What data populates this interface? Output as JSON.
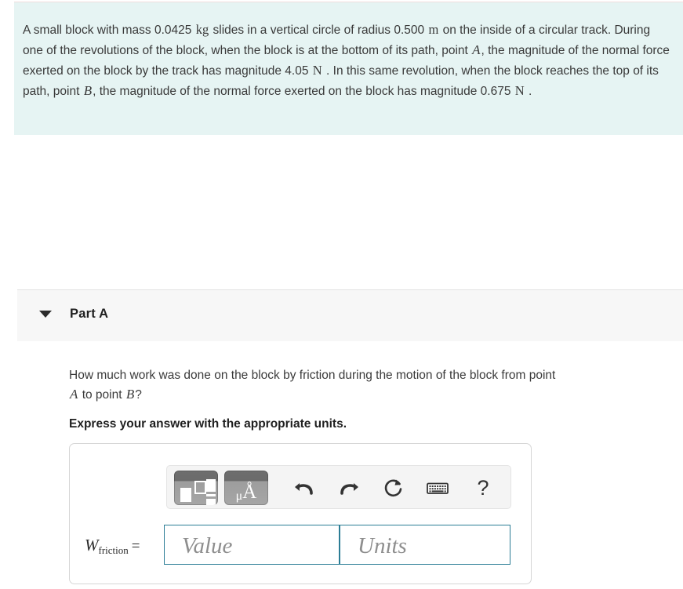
{
  "problem": {
    "text_segments": [
      {
        "t": "A small block with mass 0.0425 ",
        "k": "plain"
      },
      {
        "t": "kg",
        "k": "unit"
      },
      {
        "t": " slides in a vertical circle of radius 0.500 ",
        "k": "plain"
      },
      {
        "t": "m",
        "k": "unit"
      },
      {
        "t": " on the inside of a circular track. During one of the revolutions of the block, when the block is at the bottom of its path, point ",
        "k": "plain"
      },
      {
        "t": "A",
        "k": "var"
      },
      {
        "t": ", the magnitude of the normal force exerted on the block by the track has magnitude 4.05 ",
        "k": "plain"
      },
      {
        "t": "N",
        "k": "unit"
      },
      {
        "t": " . In this same revolution, when the block reaches the top of its path, point ",
        "k": "plain"
      },
      {
        "t": "B",
        "k": "var"
      },
      {
        "t": ", the magnitude of the normal force exerted on the block has magnitude 0.675 ",
        "k": "plain"
      },
      {
        "t": "N",
        "k": "unit"
      },
      {
        "t": " .",
        "k": "plain"
      }
    ],
    "mass": "0.0425 kg",
    "radius": "0.500 m",
    "normal_force_bottom": "4.05 N",
    "normal_force_top": "0.675 N",
    "point_bottom": "A",
    "point_top": "B",
    "background_color": "#e6f4f3"
  },
  "part": {
    "title": "Part A",
    "caret_icon": "caret-down-icon",
    "expanded": true,
    "header_background": "#f7f7f7",
    "question_line1": "How much work was done on the block by friction during the motion of the block from point",
    "question_line2_prefix": "",
    "question_line2_var_a": "A",
    "question_line2_mid": " to point ",
    "question_line2_var_b": "B",
    "question_line2_suffix": "?",
    "instruction": "Express your answer with the appropriate units."
  },
  "answer": {
    "label_symbol": "W",
    "label_subscript": "friction",
    "label_equals": "=",
    "value_placeholder": "Value",
    "units_placeholder": "Units",
    "value_current": "",
    "units_current": "",
    "field_border_color": "#2b7d95"
  },
  "toolbar": {
    "buttons": [
      {
        "name": "math-templates-button",
        "icon": "math-templates-icon",
        "label": ""
      },
      {
        "name": "units-button",
        "icon": "units-icon",
        "label": "μÅ"
      },
      {
        "name": "undo-button",
        "icon": "undo-icon",
        "label": ""
      },
      {
        "name": "redo-button",
        "icon": "redo-icon",
        "label": ""
      },
      {
        "name": "reset-button",
        "icon": "reset-icon",
        "label": ""
      },
      {
        "name": "keyboard-button",
        "icon": "keyboard-icon",
        "label": ""
      },
      {
        "name": "help-button",
        "icon": "help-icon",
        "label": "?"
      }
    ],
    "units_glyph_mu": "μ",
    "units_glyph_a": "Å",
    "help_symbol": "?",
    "background": "#f4f4f4"
  }
}
